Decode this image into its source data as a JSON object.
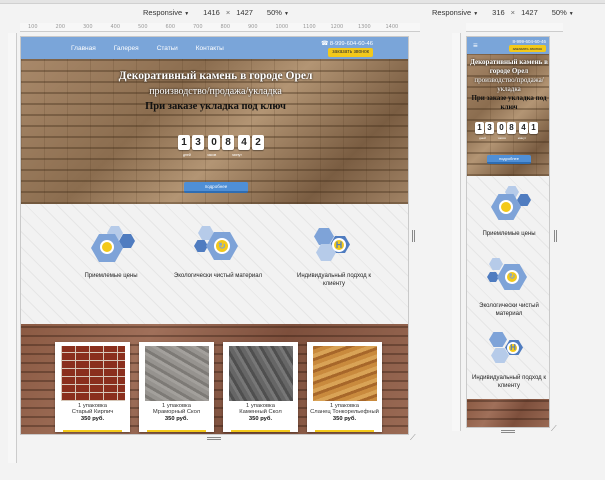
{
  "devtools": {
    "left": {
      "mode": "Responsive",
      "width": "1416",
      "height": "1427",
      "zoom": "50%",
      "times": "×"
    },
    "right": {
      "mode": "Responsive",
      "width": "316",
      "height": "1427",
      "zoom": "50%",
      "times": "×"
    },
    "ruler_ticks": [
      "100",
      "200",
      "300",
      "400",
      "500",
      "600",
      "700",
      "800",
      "900",
      "1000",
      "1100",
      "1200",
      "1300",
      "1400"
    ]
  },
  "site": {
    "nav": [
      "Главная",
      "Галерея",
      "Статьи",
      "Контакты"
    ],
    "phone": "8-999-604-60-46",
    "call_button": "заказать звонок",
    "hero": {
      "line1": "Декоративный камень в городе Орел",
      "line2": "производство/продажа/укладка",
      "line3": "При заказе укладка под ключ"
    },
    "timer_desktop": [
      "1",
      "3",
      "0",
      "8",
      "4",
      "2"
    ],
    "timer_mobile": [
      "1",
      "3",
      "0",
      "8",
      "4",
      "1"
    ],
    "timer_labels": [
      "дней",
      "часов",
      "минут"
    ],
    "cta": "подробнее",
    "features": [
      {
        "label": "Приемлемые цены",
        "icon": "coins-icon"
      },
      {
        "label": "Экологически чистый материал",
        "icon": "recycle-icon"
      },
      {
        "label": "Индивидуальный подход к клиенту",
        "icon": "person-icon"
      }
    ],
    "products": [
      {
        "line1": "1 упаковка",
        "line2": "Старый Кирпич",
        "price": "350 руб.",
        "color": "#8a2f1d"
      },
      {
        "line1": "1 упаковка",
        "line2": "Мраморный Скол",
        "price": "350 руб.",
        "color": "#8d8a86"
      },
      {
        "line1": "1 упаковка",
        "line2": "Каменный Скол",
        "price": "350 руб.",
        "color": "#5f5f5f"
      },
      {
        "line1": "1 упаковка",
        "line2": "Сланец Тонкорельефный",
        "price": "350 руб.",
        "color": "#b9782e"
      }
    ]
  },
  "mobile_features": [
    "Приемлемые цены",
    "Экологически чистый материал",
    "Индивидуальный подход к клиенту"
  ]
}
